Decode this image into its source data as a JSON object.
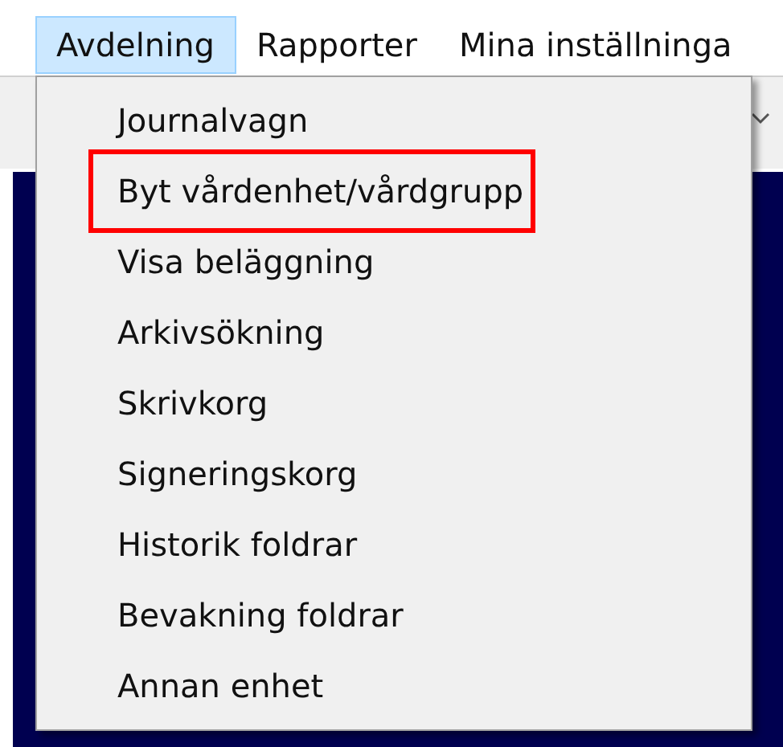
{
  "menu_bar": [
    {
      "label": "Avdelning",
      "selected": true
    },
    {
      "label": "Rapporter",
      "selected": false
    },
    {
      "label": "Mina inställninga",
      "selected": false
    }
  ],
  "dropdown": {
    "items": [
      {
        "label": "Journalvagn",
        "highlighted": false
      },
      {
        "label": "Byt vårdenhet/vårdgrupp",
        "highlighted": true
      },
      {
        "label": "Visa beläggning",
        "highlighted": false
      },
      {
        "label": "Arkivsökning",
        "highlighted": false
      },
      {
        "label": "Skrivkorg",
        "highlighted": false
      },
      {
        "label": "Signeringskorg",
        "highlighted": false
      },
      {
        "label": "Historik foldrar",
        "highlighted": false
      },
      {
        "label": "Bevakning foldrar",
        "highlighted": false
      },
      {
        "label": "Annan enhet",
        "highlighted": false
      }
    ]
  }
}
